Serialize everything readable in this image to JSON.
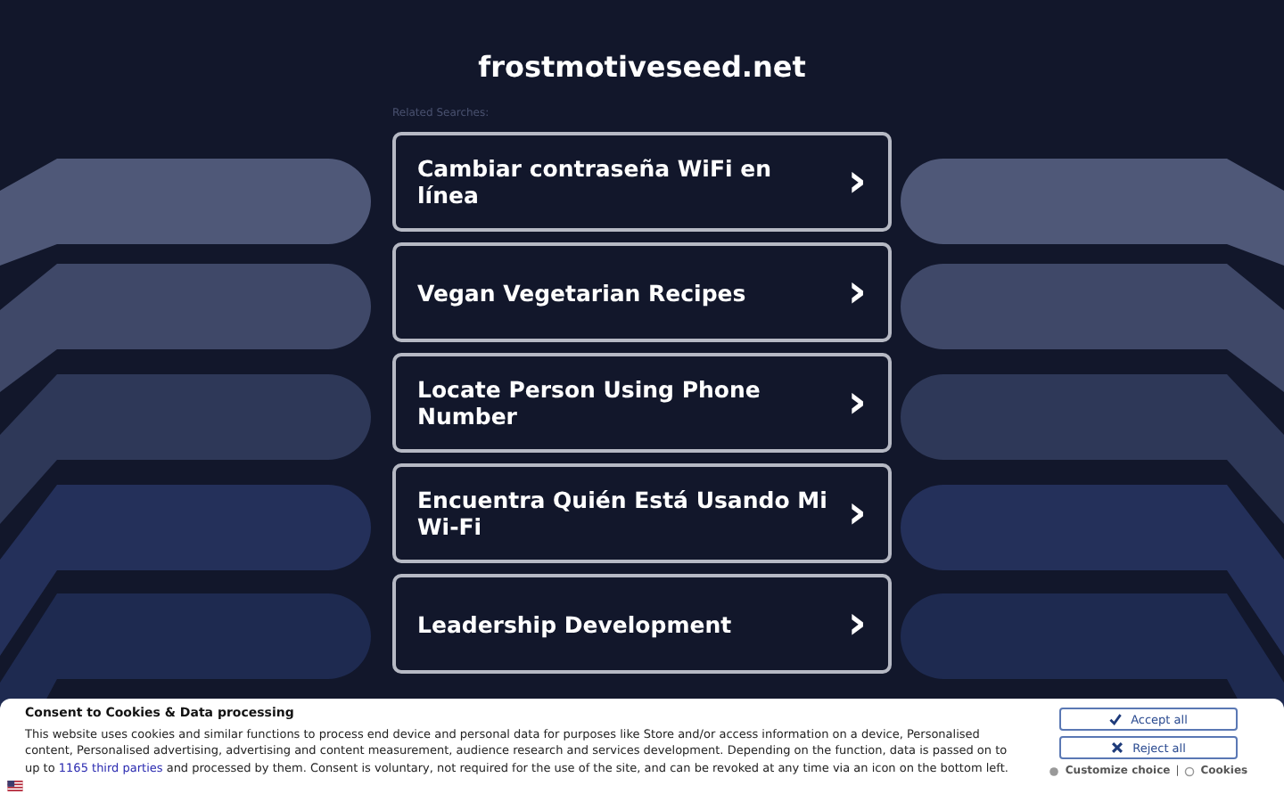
{
  "site_title": "frostmotiveseed.net",
  "related_label": "Related Searches:",
  "searches": [
    {
      "label": "Cambiar contraseña WiFi en línea",
      "arrow": "›"
    },
    {
      "label": "Vegan Vegetarian Recipes",
      "arrow": "›"
    },
    {
      "label": "Locate Person Using Phone Number",
      "arrow": "›"
    },
    {
      "label": "Encuentra Quién Está Usando Mi Wi-Fi",
      "arrow": "›"
    },
    {
      "label": "Leadership Development",
      "arrow": "›"
    }
  ],
  "consent": {
    "title": "Consent to Cookies & Data processing",
    "text_before": "This website uses cookies and similar functions to process end device and personal data for purposes like Store and/or access information on a device, Personalised content, Personalised advertising, advertising and content measurement, audience research and services development. Depending on the function, data is passed on to up to",
    "link": "1165 third parties",
    "text_after": "and processed by them. Consent is voluntary, not required for the use of the site, and can be revoked at any time via an icon on the bottom left.",
    "accept": "Accept all",
    "reject": "Reject all",
    "customize": "Customize choice",
    "separator": "|",
    "cookies": "Cookies"
  }
}
